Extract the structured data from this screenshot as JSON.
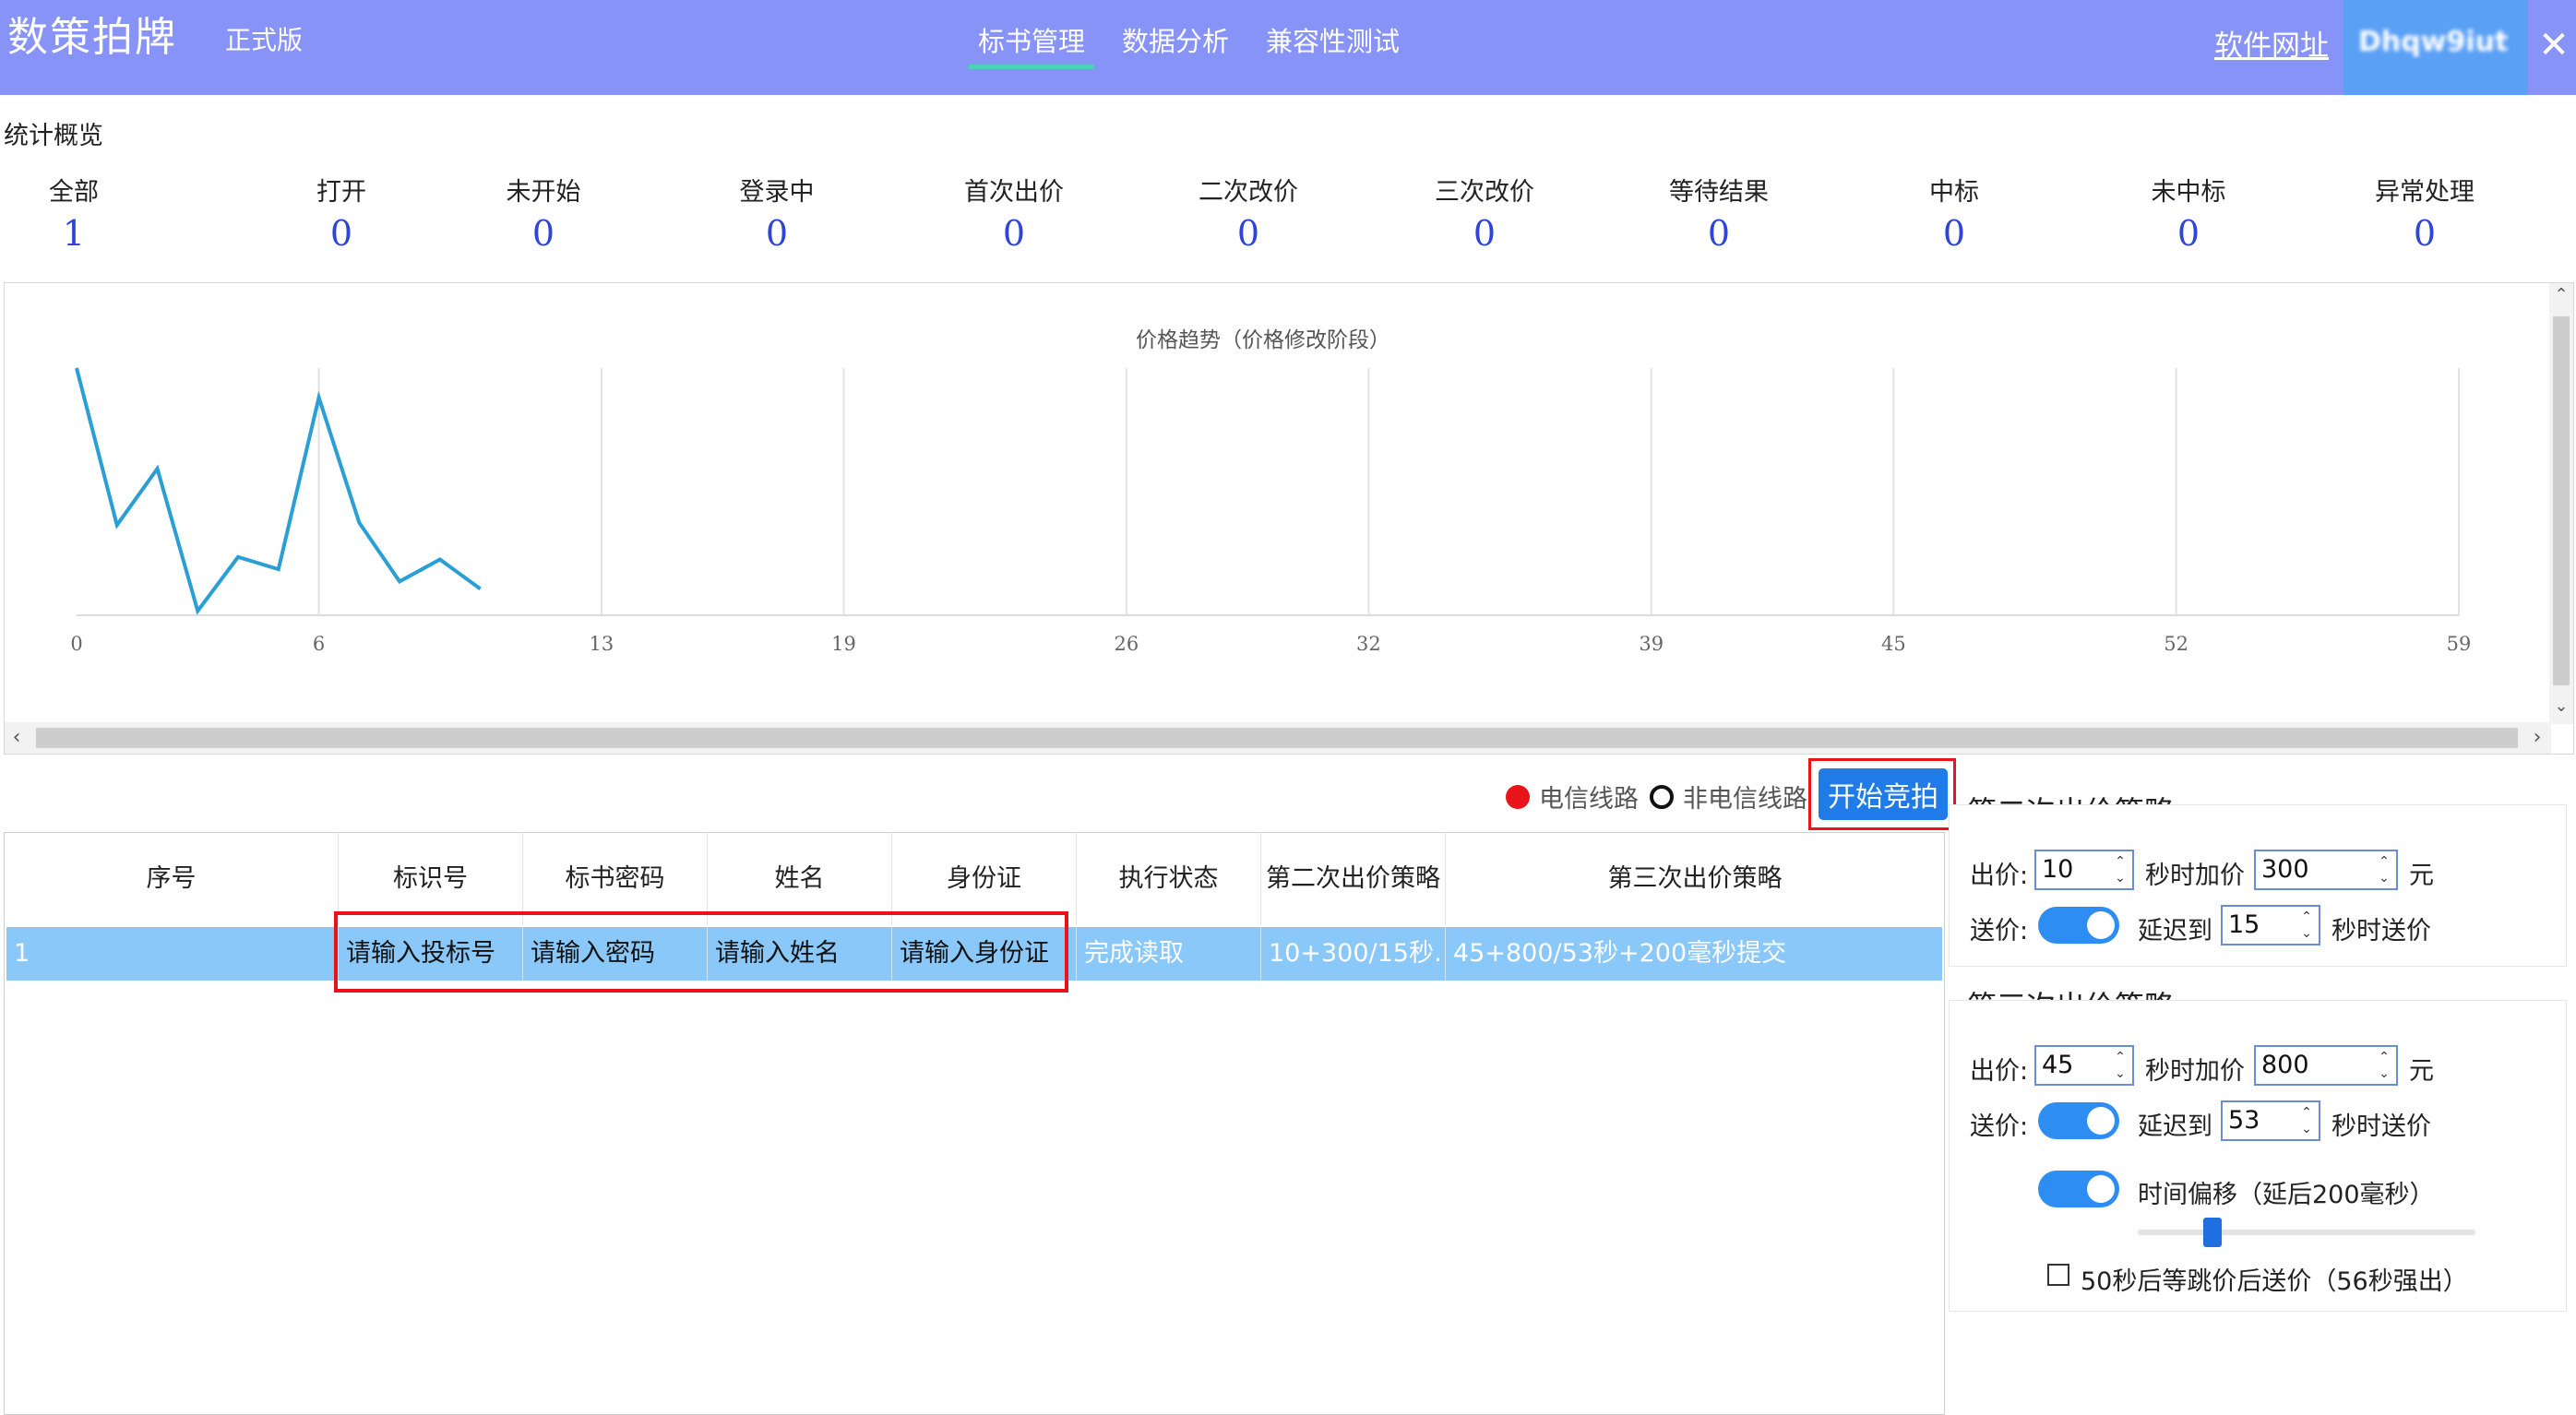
{
  "header": {
    "app_title": "数策拍牌",
    "edition": "正式版",
    "tabs": [
      {
        "label": "标书管理",
        "active": true
      },
      {
        "label": "数据分析",
        "active": false
      },
      {
        "label": "兼容性测试",
        "active": false
      }
    ],
    "site_link": "软件网址",
    "user_name": "Dhqw9iut",
    "close_symbol": "✕"
  },
  "stats": {
    "title": "统计概览",
    "items": [
      {
        "label": "全部",
        "value": "1"
      },
      {
        "label": "打开",
        "value": "0"
      },
      {
        "label": "未开始",
        "value": "0"
      },
      {
        "label": "登录中",
        "value": "0"
      },
      {
        "label": "首次出价",
        "value": "0"
      },
      {
        "label": "二次改价",
        "value": "0"
      },
      {
        "label": "三次改价",
        "value": "0"
      },
      {
        "label": "等待结果",
        "value": "0"
      },
      {
        "label": "中标",
        "value": "0"
      },
      {
        "label": "未中标",
        "value": "0"
      },
      {
        "label": "异常处理",
        "value": "0"
      }
    ]
  },
  "chart_data": {
    "type": "line",
    "title": "价格趋势（价格修改阶段）",
    "xlabel": "",
    "ylabel": "",
    "xlim": [
      0,
      59
    ],
    "xticks": [
      0,
      6,
      13,
      19,
      26,
      32,
      39,
      45,
      52,
      59
    ],
    "ylim": [
      0,
      10
    ],
    "grid": "vertical",
    "color": "#2a9fd6",
    "series": [
      {
        "x": [
          0,
          1,
          2,
          3,
          4,
          5,
          6,
          7,
          8,
          9,
          10
        ],
        "y": [
          10,
          3.6,
          5.9,
          0.1,
          2.3,
          1.8,
          8.8,
          3.7,
          1.3,
          2.2,
          1.0
        ]
      }
    ]
  },
  "toolbar": {
    "telecom_label": "电信线路",
    "non_telecom_label": "非电信线路",
    "start_label": "开始竞拍",
    "telecom_color": "#e8141a"
  },
  "table": {
    "headers": [
      "序号",
      "标识号",
      "标书密码",
      "姓名",
      "身份证",
      "执行状态",
      "第二次出价策略",
      "第三次出价策略"
    ],
    "rows": [
      [
        "1",
        "请输入投标号",
        "请输入密码",
        "请输入姓名",
        "请输入身份证",
        "完成读取",
        "10+300/15秒…",
        "45+800/53秒+200毫秒提交"
      ]
    ],
    "selected_color": "#89c8f9"
  },
  "strategy2": {
    "title": "第二次出价策略",
    "bid_label": "出价:",
    "bid_seconds": "10",
    "add_label": "秒时加价",
    "add_amount": "300",
    "unit": "元",
    "send_label": "送价:",
    "delay_label": "延迟到",
    "delay_seconds": "15",
    "send_suffix": "秒时送价",
    "send_enabled": true
  },
  "strategy3": {
    "title": "第三次出价策略",
    "bid_label": "出价:",
    "bid_seconds": "45",
    "add_label": "秒时加价",
    "add_amount": "800",
    "unit": "元",
    "send_label": "送价:",
    "delay_label": "延迟到",
    "delay_seconds": "53",
    "send_suffix": "秒时送价",
    "send_enabled": true,
    "offset_label": "时间偏移（延后200毫秒）",
    "offset_enabled": true,
    "offset_slider_fraction": 0.22,
    "wait_label": "50秒后等跳价后送价（56秒强出）",
    "wait_checked": false
  }
}
